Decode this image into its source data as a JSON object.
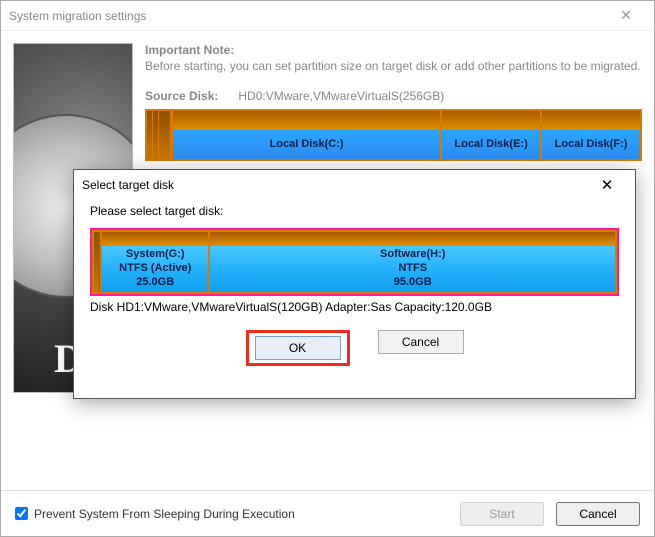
{
  "main": {
    "title": "System migration settings",
    "note_title": "Important Note:",
    "note_text": "Before starting, you can set partition size on target disk or add other partitions to be migrated.",
    "source_label": "Source Disk:",
    "source_value": "HD0:VMware,VMwareVirtualS(256GB)",
    "partitions": [
      {
        "label": "Local Disk(C:)",
        "flex": 3
      },
      {
        "label": "Local Disk(E:)",
        "flex": 1.1
      },
      {
        "label": "Local Disk(F:)",
        "flex": 1.1
      }
    ]
  },
  "footer": {
    "checkbox_label": "Prevent System From Sleeping During Execution",
    "checkbox_checked": true,
    "start_label": "Start",
    "cancel_label": "Cancel"
  },
  "modal": {
    "title": "Select target disk",
    "prompt": "Please select target disk:",
    "partitions": [
      {
        "name": "System(G:)",
        "fs": "NTFS (Active)",
        "size": "25.0GB",
        "flex": 1
      },
      {
        "name": "Software(H:)",
        "fs": "NTFS",
        "size": "95.0GB",
        "flex": 3.8
      }
    ],
    "disk_desc": "Disk HD1:VMware,VMwareVirtualS(120GB)  Adapter:Sas  Capacity:120.0GB",
    "ok_label": "OK",
    "cancel_label": "Cancel"
  }
}
